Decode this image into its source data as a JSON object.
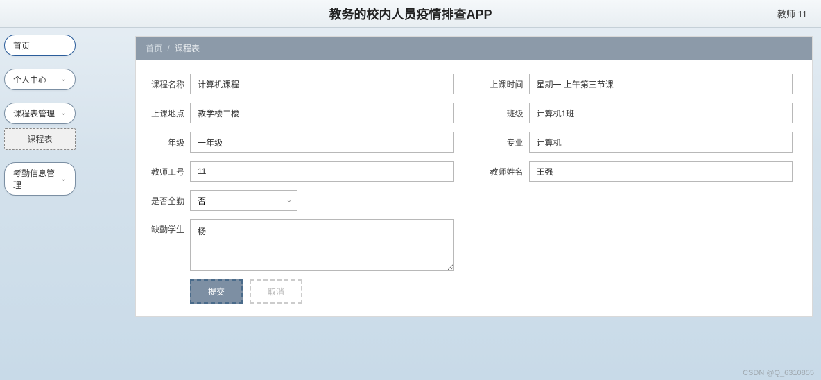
{
  "header": {
    "title": "教务的校内人员疫情排查APP",
    "user": "教师 11"
  },
  "sidebar": {
    "items": [
      {
        "label": "首页",
        "expandable": false
      },
      {
        "label": "个人中心",
        "expandable": true
      },
      {
        "label": "课程表管理",
        "expandable": true
      },
      {
        "label": "考勤信息管理",
        "expandable": true
      }
    ],
    "sub_active": "课程表"
  },
  "breadcrumb": {
    "root": "首页",
    "current": "课程表"
  },
  "form": {
    "course_name": {
      "label": "课程名称",
      "value": "计算机课程"
    },
    "class_time": {
      "label": "上课时间",
      "value": "星期一 上午第三节课"
    },
    "location": {
      "label": "上课地点",
      "value": "教学楼二楼"
    },
    "class": {
      "label": "班级",
      "value": "计算机1班"
    },
    "grade": {
      "label": "年级",
      "value": "一年级"
    },
    "major": {
      "label": "专业",
      "value": "计算机"
    },
    "teacher_id": {
      "label": "教师工号",
      "value": "11"
    },
    "teacher_name": {
      "label": "教师姓名",
      "value": "王强"
    },
    "full_attend": {
      "label": "是否全勤",
      "value": "否"
    },
    "absent": {
      "label": "缺勤学生",
      "value": "杨"
    }
  },
  "buttons": {
    "submit": "提交",
    "cancel": "取消"
  },
  "watermark": "CSDN @Q_6310855"
}
